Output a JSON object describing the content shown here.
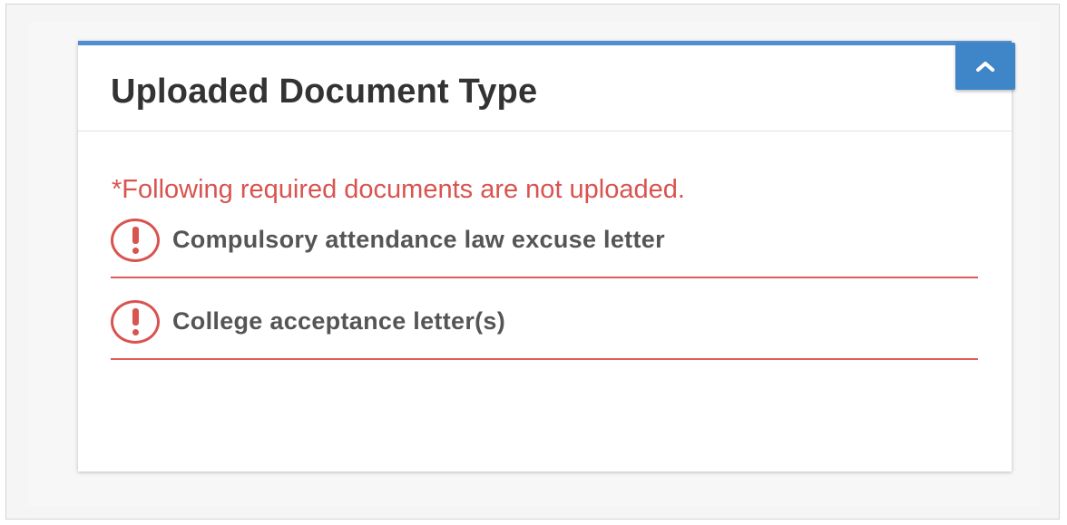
{
  "panel": {
    "title": "Uploaded Document Type",
    "collapse_icon": "chevron-up-icon",
    "warning": "*Following required documents are not uploaded.",
    "missing_documents": [
      {
        "label": "Compulsory attendance law excuse letter",
        "icon": "alert-circle-icon"
      },
      {
        "label": "College acceptance letter(s)",
        "icon": "alert-circle-icon"
      }
    ]
  },
  "colors": {
    "accent": "#4f8fd0",
    "button": "#3f86c9",
    "warning": "#d9534f",
    "title": "#333333",
    "label": "#555555"
  }
}
